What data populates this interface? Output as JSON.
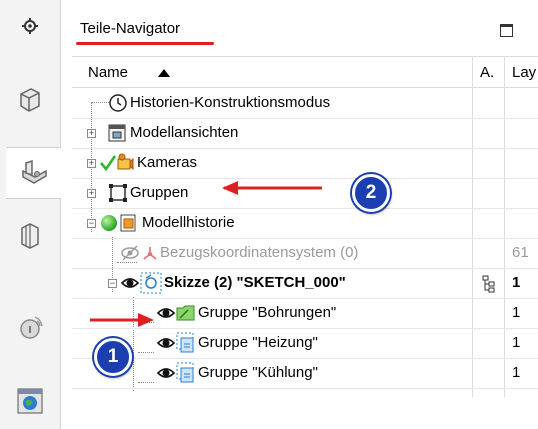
{
  "panel": {
    "title": "Teile-Navigator"
  },
  "columns": {
    "name": "Name",
    "a": "A.",
    "layer": "Lay"
  },
  "rows": [
    {
      "label": "Historien-Konstruktionsmodus"
    },
    {
      "label": "Modellansichten"
    },
    {
      "label": "Kameras"
    },
    {
      "label": "Gruppen"
    },
    {
      "label": "Modellhistorie"
    },
    {
      "label": "Bezugskoordinatensystem (0)",
      "layer": "61"
    },
    {
      "label": "Skizze (2) \"SKETCH_000\"",
      "layer": "1"
    },
    {
      "label": "Gruppe \"Bohrungen\"",
      "layer": "1"
    },
    {
      "label": "Gruppe \"Heizung\"",
      "layer": "1"
    },
    {
      "label": "Gruppe \"Kühlung\"",
      "layer": "1"
    }
  ],
  "annotations": {
    "badge1": "1",
    "badge2": "2"
  },
  "colors": {
    "annotation_red": "#e02020",
    "badge_blue": "#1b3fb0",
    "check_green": "#2fb52f"
  }
}
